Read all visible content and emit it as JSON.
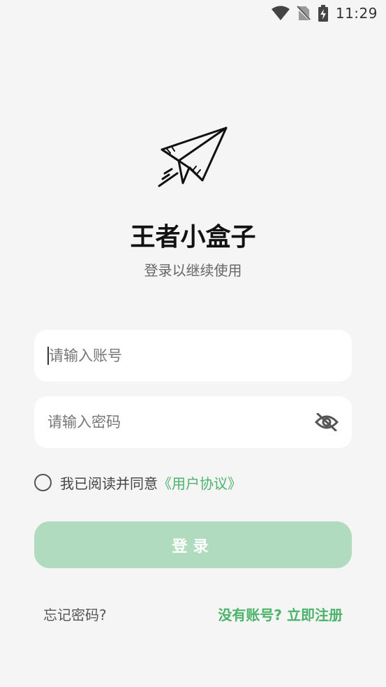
{
  "status_bar": {
    "time": "11:29",
    "icons": [
      "wifi-icon",
      "no-sim-icon",
      "battery-charging-icon"
    ]
  },
  "logo": {
    "icon": "paper-plane-icon"
  },
  "header": {
    "title": "王者小盒子",
    "subtitle": "登录以继续使用"
  },
  "form": {
    "account_placeholder": "请输入账号",
    "account_value": "",
    "password_placeholder": "请输入密码",
    "password_value": "",
    "password_toggle_icon": "eye-off-icon",
    "agreement_checked": false,
    "agreement_text": "我已阅读并同意",
    "agreement_link": "《用户协议》",
    "login_label": "登录"
  },
  "footer": {
    "forgot_label": "忘记密码?",
    "register_label": "没有账号? 立即注册"
  },
  "colors": {
    "accent": "#4cb36a",
    "button_disabled": "#b0dbbe",
    "background": "#f5f5f5"
  }
}
